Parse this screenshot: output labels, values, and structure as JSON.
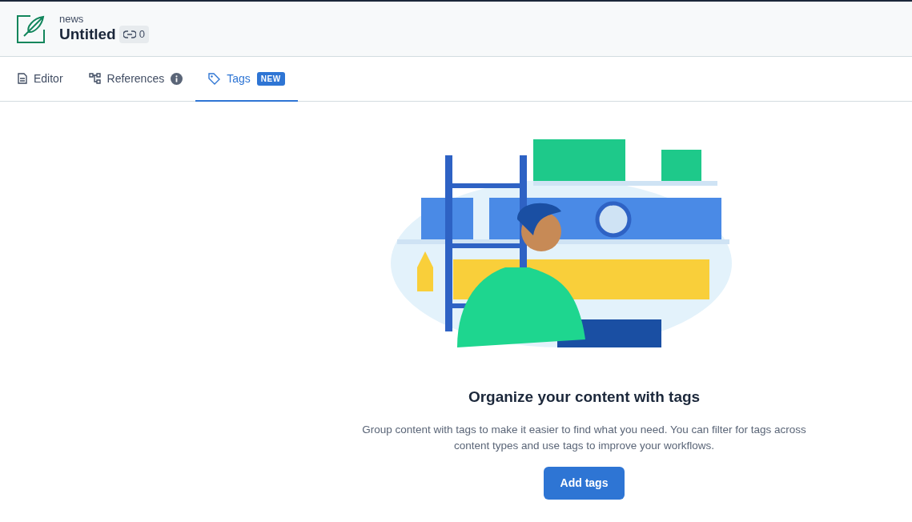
{
  "header": {
    "space": "news",
    "title": "Untitled",
    "link_count": "0"
  },
  "tabs": [
    {
      "label": "Editor",
      "selected": false,
      "kind": "plain"
    },
    {
      "label": "References",
      "selected": false,
      "kind": "info"
    },
    {
      "label": "Tags",
      "selected": true,
      "kind": "badge",
      "badge": "NEW"
    }
  ],
  "empty_state": {
    "heading": "Organize your content with tags",
    "description": "Group content with tags to make it easier to find what you need. You can filter for tags across content types and use tags to improve your workflows.",
    "button": "Add tags"
  }
}
